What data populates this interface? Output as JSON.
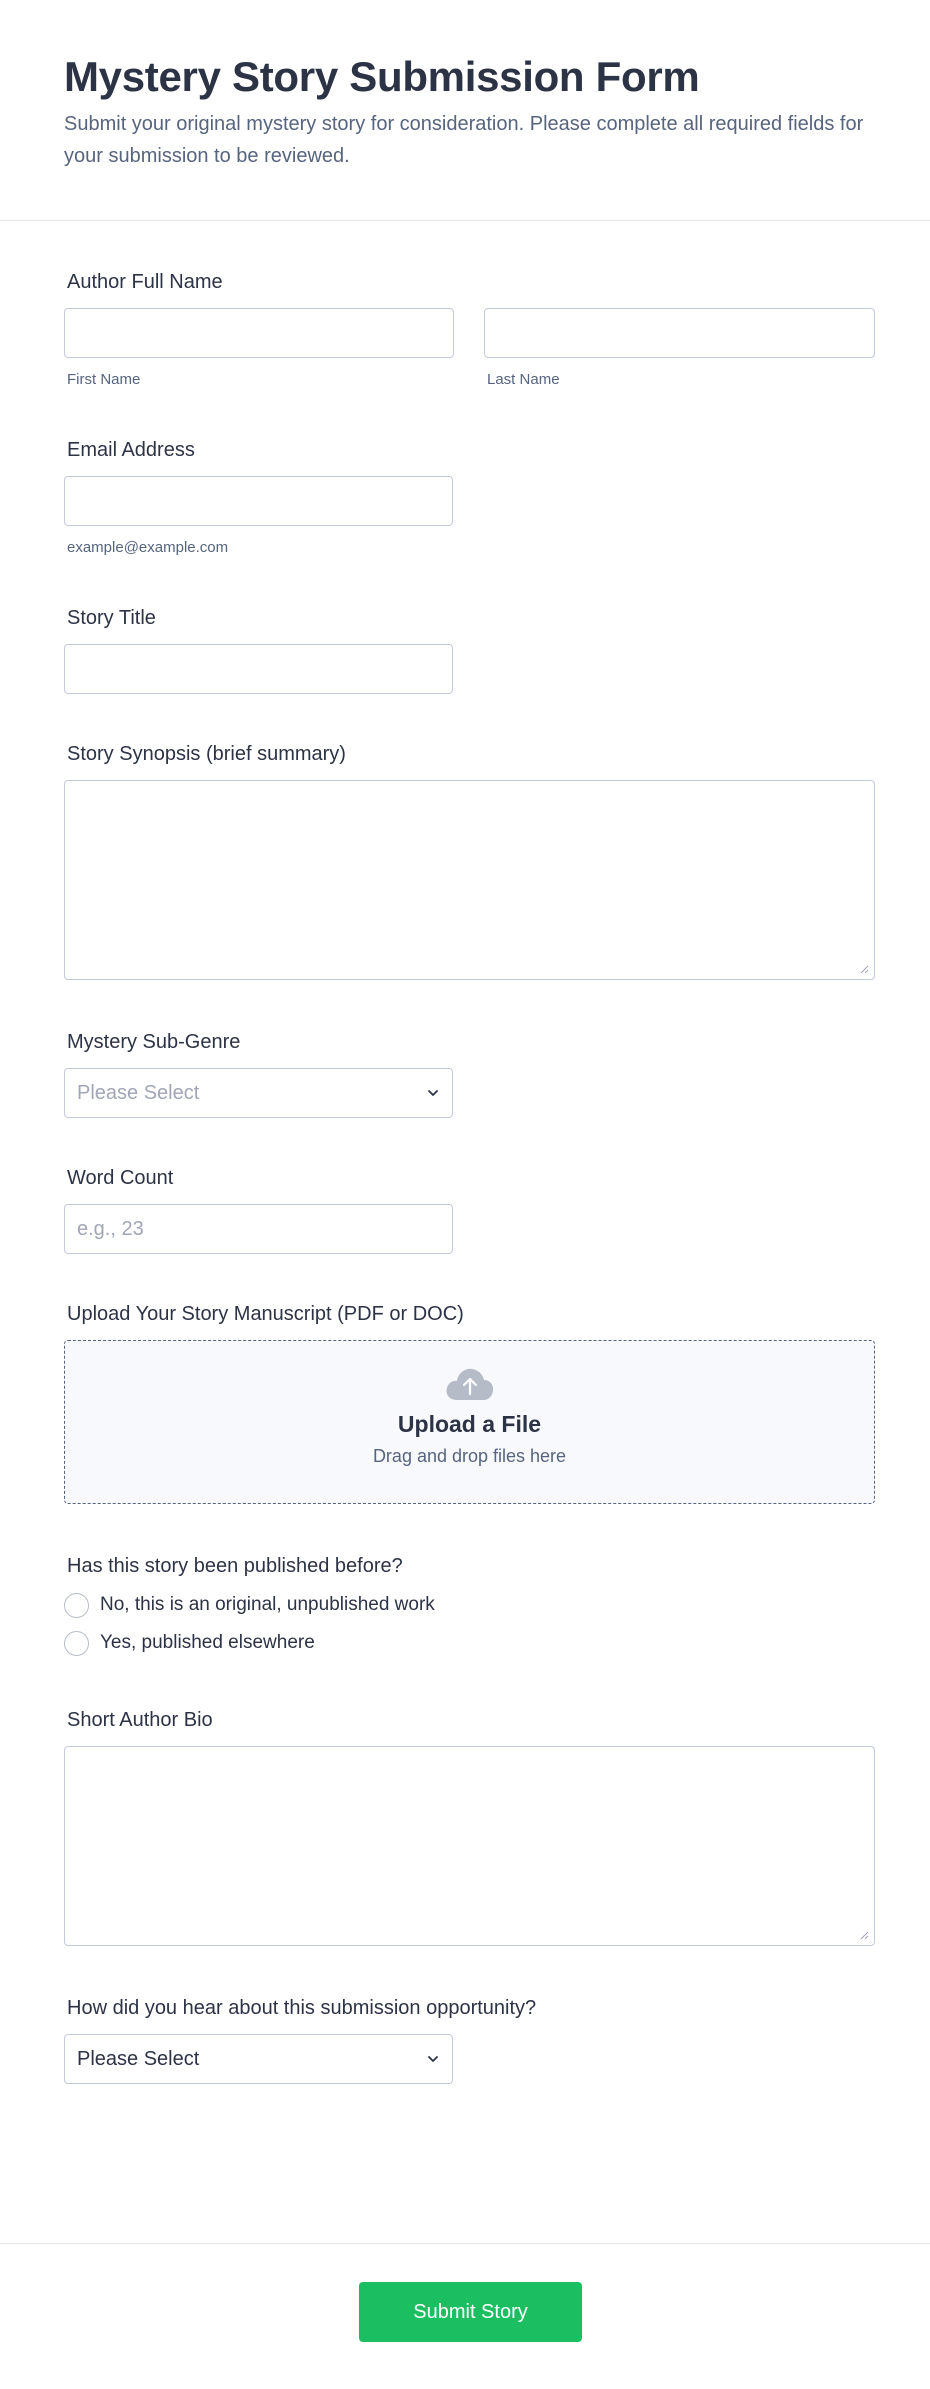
{
  "form": {
    "title": "Mystery Story Submission Form",
    "subtitle": "Submit your original mystery story for consideration. Please complete all required fields for your submission to be reviewed."
  },
  "author_name": {
    "label": "Author Full Name",
    "first_value": "",
    "last_value": "",
    "first_sublabel": "First Name",
    "last_sublabel": "Last Name"
  },
  "email": {
    "label": "Email Address",
    "value": "",
    "sublabel": "example@example.com"
  },
  "story_title": {
    "label": "Story Title",
    "value": ""
  },
  "synopsis": {
    "label": "Story Synopsis (brief summary)",
    "value": ""
  },
  "subgenre": {
    "label": "Mystery Sub-Genre",
    "selected": "Please Select"
  },
  "word_count": {
    "label": "Word Count",
    "placeholder": "e.g., 23"
  },
  "upload": {
    "label": "Upload Your Story Manuscript (PDF or DOC)",
    "title": "Upload a File",
    "subtitle": "Drag and drop files here"
  },
  "published": {
    "label": "Has this story been published before?",
    "options": [
      "No, this is an original, unpublished work",
      "Yes, published elsewhere"
    ]
  },
  "bio": {
    "label": "Short Author Bio",
    "value": ""
  },
  "referral": {
    "label": "How did you hear about this submission opportunity?",
    "selected": "Please Select"
  },
  "submit": {
    "label": "Submit Story",
    "color": "#1bbf61"
  },
  "icons": {
    "upload": "cloud-upload-icon",
    "select": "chevron-down-icon",
    "resize": "resize-grip-icon"
  }
}
